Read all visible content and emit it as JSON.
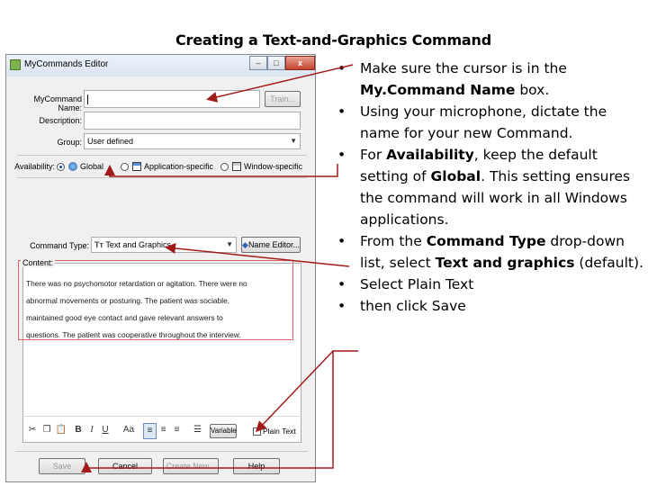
{
  "slide": {
    "title": "Creating a Text-and-Graphics Command"
  },
  "window": {
    "title": "MyCommands Editor",
    "controls": {
      "minimize": "–",
      "maximize": "□",
      "close": "x"
    }
  },
  "form": {
    "command_name_label": "MyCommand Name:",
    "train_label": "Train...",
    "description_label": "Description:",
    "group_label": "Group:",
    "group_value": "User defined",
    "availability_label": "Availability:",
    "availability_options": [
      "Global",
      "Application-specific",
      "Window-specific"
    ],
    "command_type_label": "Command Type:",
    "command_type_value": "Text and Graphics",
    "name_editor_label": "Name Editor...",
    "content_label": "Content:",
    "content_lines": [
      "There was no psychomotor retardation or agitation. There were no",
      "abnormal movements or posturing. The patient was sociable,",
      "maintained good eye contact and gave relevant answers to",
      "questions. The patient was cooperative throughout the interview."
    ]
  },
  "toolbar": {
    "bold": "B",
    "italic": "I",
    "underline": "U",
    "font": "Aa",
    "variable_label": "Variable",
    "plain_text_label": "Plain Text"
  },
  "footer_buttons": {
    "save": "Save",
    "cancel": "Cancel",
    "create_new": "Create New...",
    "help": "Help"
  },
  "bullets": [
    {
      "parts": [
        {
          "t": "Make sure the cursor is in the "
        },
        {
          "t": "My.Command Name",
          "b": true
        },
        {
          "t": " box."
        }
      ]
    },
    {
      "parts": [
        {
          "t": "Using your microphone, dictate the name for your new Command."
        }
      ]
    },
    {
      "parts": [
        {
          "t": "For "
        },
        {
          "t": "Availability",
          "b": true
        },
        {
          "t": ", keep the default setting of "
        },
        {
          "t": "Global",
          "b": true
        },
        {
          "t": ". This setting ensures the command will work  in all Windows applications."
        }
      ]
    },
    {
      "parts": [
        {
          "t": "From the "
        },
        {
          "t": "Command Type",
          "b": true
        },
        {
          "t": " drop-down list, select "
        },
        {
          "t": "Text and graphics",
          "b": true
        },
        {
          "t": " (default)."
        }
      ]
    },
    {
      "parts": [
        {
          "t": "Select Plain Text"
        }
      ]
    },
    {
      "parts": [
        {
          "t": "then click Save"
        }
      ]
    }
  ],
  "bullet_glyph": "•",
  "colors": {
    "arrow": "#a11b1b",
    "highlight": "#e06666"
  }
}
